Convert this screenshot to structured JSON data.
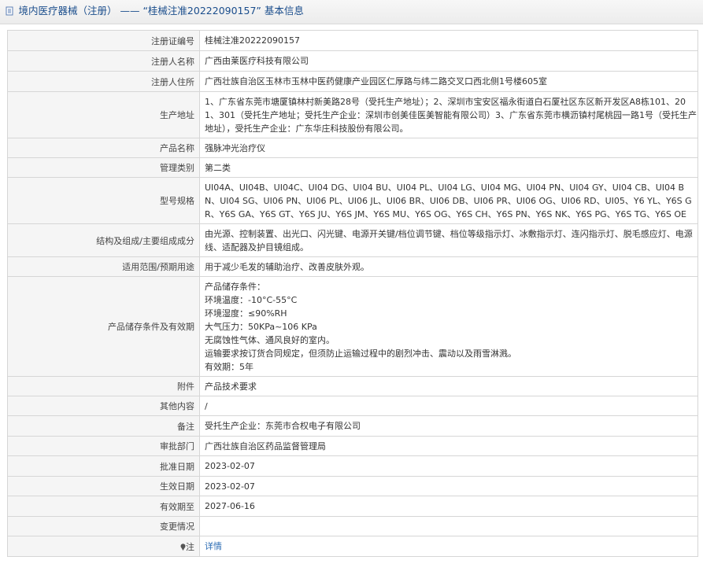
{
  "page": {
    "title": "境内医疗器械（注册） —— “桂械注准20222090157” 基本信息"
  },
  "rows": [
    {
      "label": "注册证编号",
      "value": "桂械注准20222090157"
    },
    {
      "label": "注册人名称",
      "value": "广西由莱医疗科技有限公司"
    },
    {
      "label": "注册人住所",
      "value": "广西壮族自治区玉林市玉林中医药健康产业园区仁厚路与纬二路交叉口西北侧1号楼605室"
    },
    {
      "label": "生产地址",
      "value": "1、广东省东莞市塘厦镇林村新美路28号（受托生产地址）；2、深圳市宝安区福永街道白石厦社区东区新开发区A8栋101、201、301（受托生产地址；受托生产企业：深圳市创美佳医美智能有限公司）3、广东省东莞市横沥镇村尾桃园一路1号（受托生产地址），受托生产企业：广东华庄科技股份有限公司。"
    },
    {
      "label": "产品名称",
      "value": "强脉冲光治疗仪"
    },
    {
      "label": "管理类别",
      "value": "第二类"
    },
    {
      "label": "型号规格",
      "value": "UI04A、UI04B、UI04C、UI04 DG、UI04 BU、UI04 PL、UI04 LG、UI04 MG、UI04 PN、UI04 GY、UI04 CB、UI04 BN、UI04 SG、UI06 PN、UI06 PL、UI06 JL、UI06 BR、UI06 DB、UI06 PR、UI06 OG、UI06 RD、UI05、Y6 YL、Y6S GR、Y6S GA、Y6S GT、Y6S JU、Y6S JM、Y6S MU、Y6S OG、Y6S CH、Y6S PN、Y6S NK、Y6S PG、Y6S TG、Y6S OE"
    },
    {
      "label": "结构及组成/主要组成成分",
      "value": "由光源、控制装置、出光口、闪光键、电源开关键/档位调节键、档位等级指示灯、冰敷指示灯、连闪指示灯、脱毛感应灯、电源线、适配器及护目镜组成。"
    },
    {
      "label": "适用范围/预期用途",
      "value": "用于减少毛发的辅助治疗、改善皮肤外观。"
    },
    {
      "label": "产品储存条件及有效期",
      "lines": [
        "产品储存条件：",
        "环境温度：-10°C-55°C",
        "环境湿度：≤90%RH",
        "大气压力：50KPa~106 KPa",
        "无腐蚀性气体、通风良好的室内。",
        "运输要求按订货合同规定，但须防止运输过程中的剧烈冲击、震动以及雨雪淋溅。",
        "有效期：5年"
      ]
    },
    {
      "label": "附件",
      "value": "产品技术要求"
    },
    {
      "label": "其他内容",
      "value": "/"
    },
    {
      "label": "备注",
      "value": "受托生产企业：东莞市合权电子有限公司"
    },
    {
      "label": "审批部门",
      "value": "广西壮族自治区药品监督管理局"
    },
    {
      "label": "批准日期",
      "value": "2023-02-07"
    },
    {
      "label": "生效日期",
      "value": "2023-02-07"
    },
    {
      "label": "有效期至",
      "value": "2027-06-16"
    },
    {
      "label": "变更情况",
      "value": ""
    }
  ],
  "note_row": {
    "label": "注",
    "link": "详情",
    "icon": "pin-icon"
  },
  "colors": {
    "title": "#1a4d8c",
    "link": "#2a6bb3",
    "label_bg": "#f5f5f5",
    "border": "#d6d6d6"
  }
}
